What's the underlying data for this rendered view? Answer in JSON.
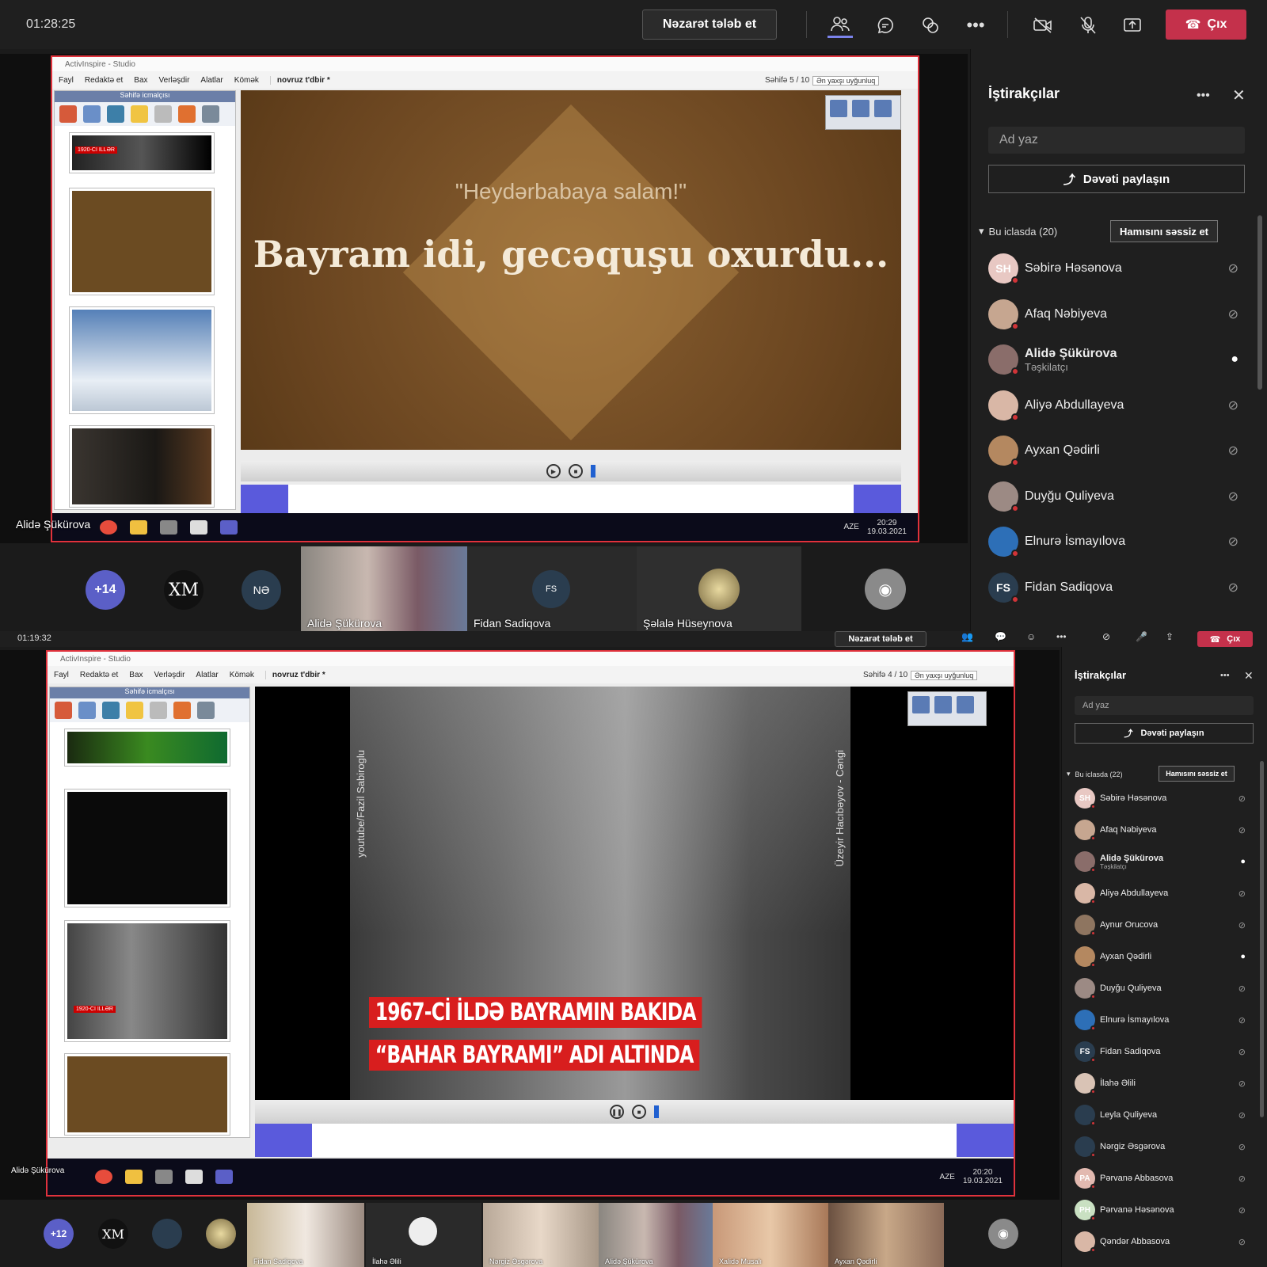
{
  "top_meeting": {
    "timer": "01:28:25",
    "request_control_label": "Nəzarət tələb et",
    "leave_label": "Çıx",
    "toolbar_icons": [
      "people-icon",
      "chat-icon",
      "reactions-icon",
      "more-icon",
      "camera-off-icon",
      "mic-off-icon",
      "share-screen-icon"
    ],
    "app_window": {
      "title": "ActivInspire - Studio",
      "menu": [
        "Fayl",
        "Redaktə et",
        "Bax",
        "Verləşdir",
        "Alatlar",
        "Kömək"
      ],
      "tab_name": "novruz t'dbir *",
      "page_indicator": "Səhifə 5 / 10",
      "zoom": "Ən yaxşı uyğunluq",
      "sorter_title": "Səhifə icmalçısı",
      "thumb_caption": "1920-CI ILLƏR"
    },
    "slide": {
      "quote": "\"Heydərbabaya salam!\"",
      "headline": "Bayram idi, gecəquşu oxurdu..."
    },
    "taskbar": {
      "lang": "AZE",
      "time": "20:29",
      "date": "19.03.2021"
    },
    "presenter_label": "Alidə Şükürova",
    "gallery": [
      {
        "type": "count",
        "label": "+14"
      },
      {
        "type": "initials",
        "label": "XM"
      },
      {
        "type": "initials",
        "label": "NƏ"
      },
      {
        "type": "video",
        "name": "Alidə Şükürova"
      },
      {
        "type": "initials",
        "label": "FS",
        "name": "Fidan Sadiqova"
      },
      {
        "type": "image",
        "name": "Şəlalə Hüseynova"
      },
      {
        "type": "self",
        "label": ""
      }
    ],
    "panel": {
      "title": "İştirakçılar",
      "search_placeholder": "Ad yaz",
      "share_invite": "Dəvəti paylaşın",
      "section_label": "Bu iclasda (20)",
      "mute_all": "Hamısını səssiz et",
      "participants": [
        {
          "initials": "SH",
          "name": "Səbirə Həsənova",
          "role": "",
          "mic": "muted",
          "color": "#e8c8c3"
        },
        {
          "initials": "",
          "name": "Afaq Nəbiyeva",
          "role": "",
          "mic": "muted",
          "color": "#c6a690"
        },
        {
          "initials": "",
          "name": "Alidə Şükürova",
          "role": "Təşkilatçı",
          "mic": "on",
          "color": "#8a6d6a"
        },
        {
          "initials": "",
          "name": "Aliyə Abdullayeva",
          "role": "",
          "mic": "muted",
          "color": "#d9b7a6"
        },
        {
          "initials": "",
          "name": "Ayxan Qədirli",
          "role": "",
          "mic": "muted",
          "color": "#b48860"
        },
        {
          "initials": "",
          "name": "Duyğu Quliyeva",
          "role": "",
          "mic": "muted",
          "color": "#9c8a84"
        },
        {
          "initials": "",
          "name": "Elnurə İsmayılova",
          "role": "",
          "mic": "muted",
          "color": "#2d6fb7"
        },
        {
          "initials": "FS",
          "name": "Fidan Sadiqova",
          "role": "",
          "mic": "muted",
          "color": "#2a3d4f"
        }
      ]
    }
  },
  "bottom_meeting": {
    "timer": "01:19:32",
    "request_control_label": "Nəzarət tələb et",
    "leave_label": "Çıx",
    "app_window": {
      "title": "ActivInspire - Studio",
      "menu": [
        "Fayl",
        "Redaktə et",
        "Bax",
        "Verləşdir",
        "Alatlar",
        "Kömək"
      ],
      "tab_name": "novruz t'dbir *",
      "page_indicator": "Səhifə 4 / 10",
      "zoom": "Ən yaxşı uyğunluq",
      "sorter_title": "Səhifə icmalçısı",
      "thumb_caption": "1920-CI ILLƏR"
    },
    "slide": {
      "caption_line1": "1967-Cİ İLDƏ BAYRAMIN BAKIDA",
      "caption_line2": "“BAHAR BAYRAMI” ADI ALTINDA",
      "side_left": "youtube/Fazil Sabiroglu",
      "side_right": "Üzeyir Hacıbəyov - Cəngi"
    },
    "taskbar": {
      "lang": "AZE",
      "time": "20:20",
      "date": "19.03.2021"
    },
    "presenter_label": "Alidə Şükürova",
    "gallery": [
      {
        "type": "count",
        "label": "+12"
      },
      {
        "type": "initials",
        "label": "XM"
      },
      {
        "type": "initials",
        "label": ""
      },
      {
        "type": "image",
        "name": ""
      },
      {
        "type": "video",
        "name": "Fidan Sadiqova"
      },
      {
        "type": "video",
        "name": "İlahə Əlili"
      },
      {
        "type": "video",
        "name": "Nərgiz Əsgərova"
      },
      {
        "type": "video",
        "name": "Alidə Şükürova"
      },
      {
        "type": "video",
        "name": "Xalidə Musalı"
      },
      {
        "type": "video",
        "name": "Ayxan Qədirli"
      }
    ],
    "panel": {
      "title": "İştirakçılar",
      "search_placeholder": "Ad yaz",
      "share_invite": "Dəvəti paylaşın",
      "section_label": "Bu iclasda (22)",
      "mute_all": "Hamısını səssiz et",
      "participants": [
        {
          "initials": "SH",
          "name": "Səbirə Həsənova",
          "role": "",
          "mic": "muted",
          "color": "#e8c8c3"
        },
        {
          "initials": "",
          "name": "Afaq Nəbiyeva",
          "role": "",
          "mic": "muted",
          "color": "#c6a690"
        },
        {
          "initials": "",
          "name": "Alidə Şükürova",
          "role": "Təşkilatçı",
          "mic": "on",
          "color": "#8a6d6a"
        },
        {
          "initials": "",
          "name": "Aliyə Abdullayeva",
          "role": "",
          "mic": "muted",
          "color": "#d9b7a6"
        },
        {
          "initials": "",
          "name": "Aynur Orucova",
          "role": "",
          "mic": "muted",
          "color": "#8e7560"
        },
        {
          "initials": "",
          "name": "Ayxan Qədirli",
          "role": "",
          "mic": "on",
          "color": "#b48860"
        },
        {
          "initials": "",
          "name": "Duyğu Quliyeva",
          "role": "",
          "mic": "muted",
          "color": "#9c8a84"
        },
        {
          "initials": "",
          "name": "Elnurə İsmayılova",
          "role": "",
          "mic": "muted",
          "color": "#2d6fb7"
        },
        {
          "initials": "FS",
          "name": "Fidan Sadiqova",
          "role": "",
          "mic": "muted",
          "color": "#2a3d4f"
        },
        {
          "initials": "",
          "name": "İlahə Əlili",
          "role": "",
          "mic": "muted",
          "color": "#d9c3b5"
        },
        {
          "initials": "",
          "name": "Leyla Quliyeva",
          "role": "",
          "mic": "muted",
          "color": "#2a3d4f"
        },
        {
          "initials": "",
          "name": "Nərgiz Əsgərova",
          "role": "",
          "mic": "muted",
          "color": "#2a3d4f"
        },
        {
          "initials": "PA",
          "name": "Pərvanə Abbasova",
          "role": "",
          "mic": "muted",
          "color": "#e2b9b0"
        },
        {
          "initials": "PH",
          "name": "Pərvanə Həsənova",
          "role": "",
          "mic": "muted",
          "color": "#c9e0c2"
        },
        {
          "initials": "",
          "name": "Qəndər Abbasova",
          "role": "",
          "mic": "muted",
          "color": "#d9b7a6"
        }
      ]
    }
  }
}
